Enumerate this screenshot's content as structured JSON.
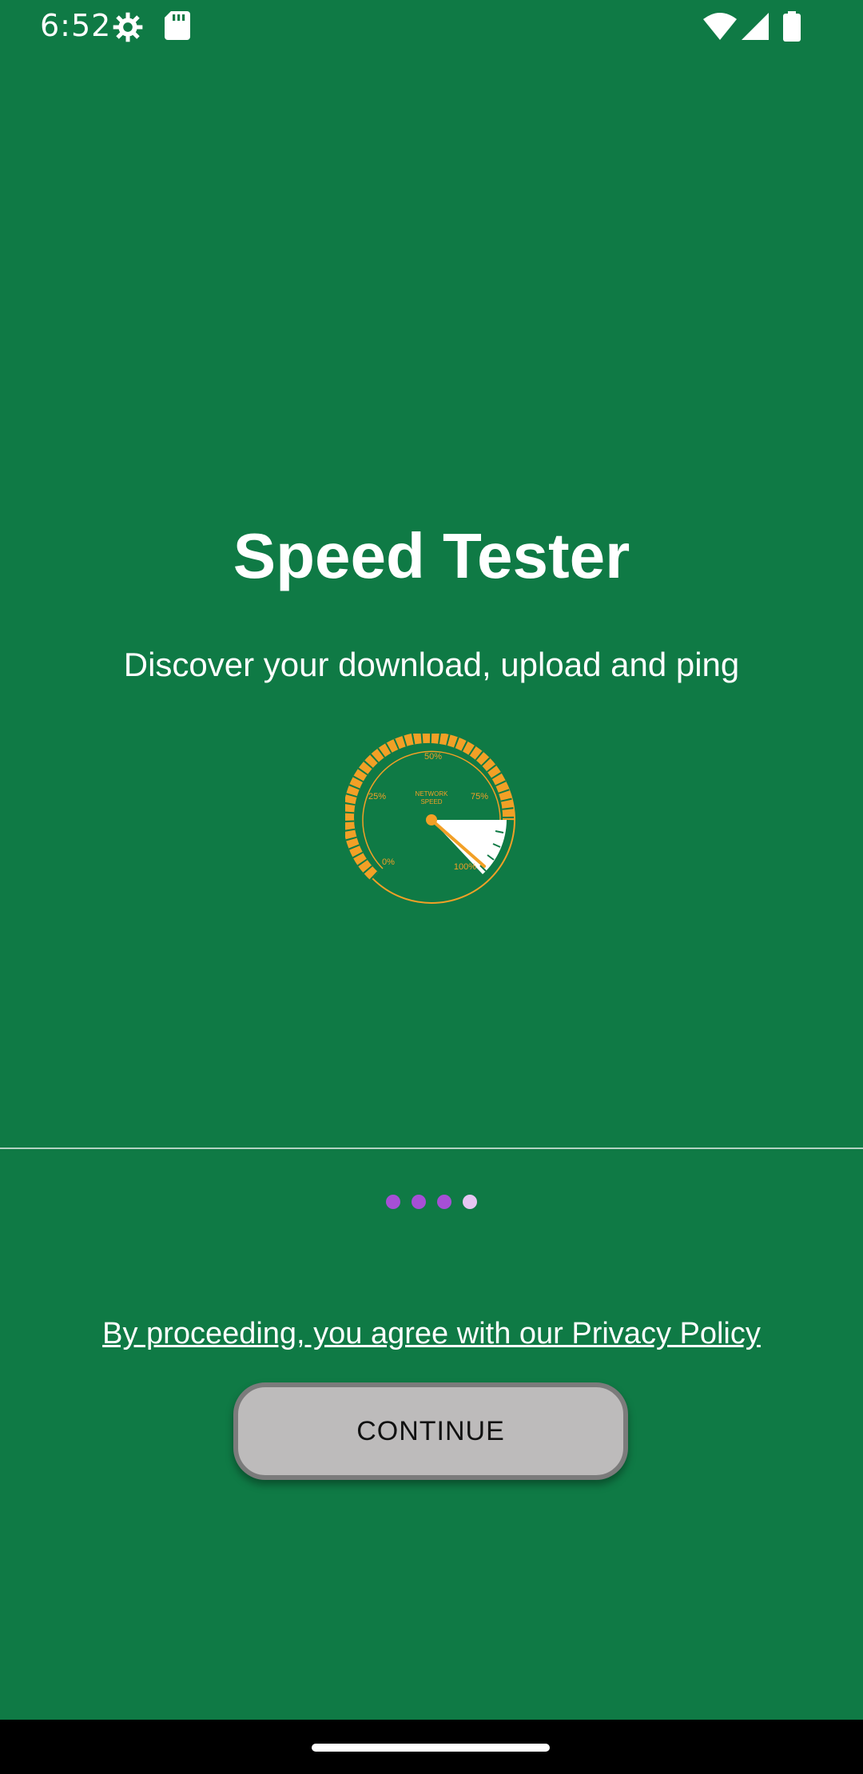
{
  "status_bar": {
    "time": "6:52",
    "icons": [
      "settings-icon",
      "sd-card-icon",
      "wifi-icon",
      "cellular-signal-icon",
      "battery-icon"
    ]
  },
  "onboarding": {
    "title": "Speed Tester",
    "subtitle": "Discover your download, upload and ping",
    "gauge": {
      "label_line1": "NETWORK",
      "label_line2": "SPEED",
      "ticks": [
        "0%",
        "25%",
        "50%",
        "75%",
        "100%"
      ],
      "needle_color": "#f2a026",
      "arc_color": "#f2a026"
    },
    "page_indicator": {
      "count": 4,
      "active_index": 3
    },
    "privacy_text": "By proceeding, you agree with our Privacy Policy",
    "continue_label": "CONTINUE"
  },
  "colors": {
    "background": "#0f7a45",
    "dot": "#a64fd6",
    "dot_active": "#e6c6f2",
    "button": "#bdbbbb"
  }
}
